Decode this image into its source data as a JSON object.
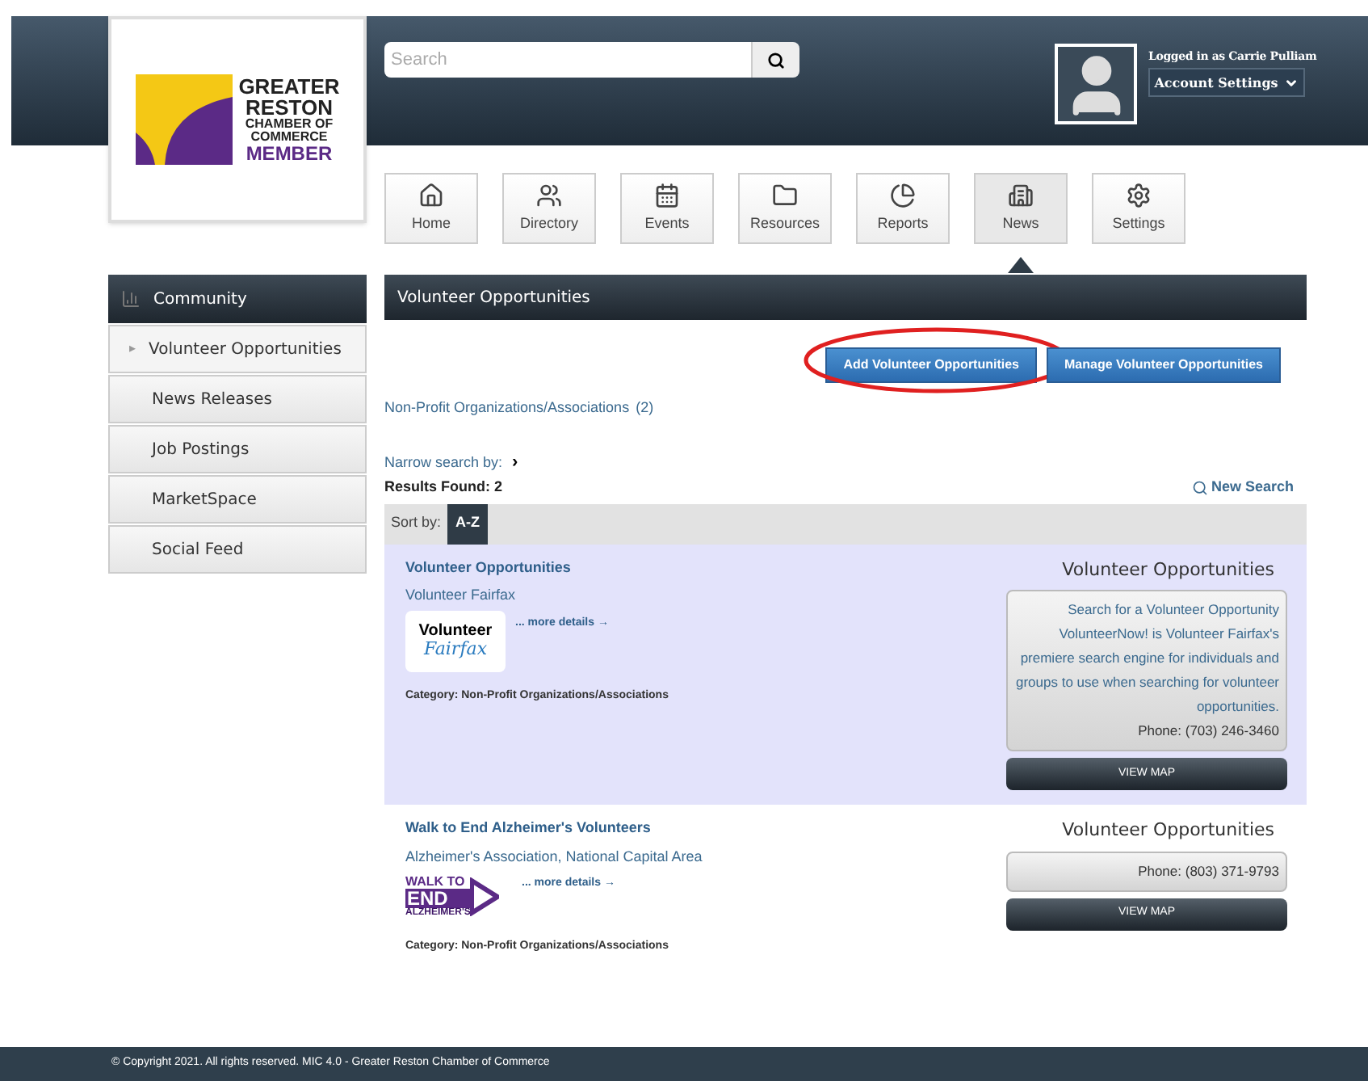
{
  "logo": {
    "lines": [
      "GREATER",
      "RESTON",
      "CHAMBER OF",
      "COMMERCE",
      "MEMBER"
    ]
  },
  "search": {
    "placeholder": "Search"
  },
  "user": {
    "status": "Logged in as Carrie Pulliam",
    "menu": "Account Settings"
  },
  "nav": [
    {
      "label": "Home",
      "selected": false
    },
    {
      "label": "Directory",
      "selected": false
    },
    {
      "label": "Events",
      "selected": false
    },
    {
      "label": "Resources",
      "selected": false
    },
    {
      "label": "Reports",
      "selected": false
    },
    {
      "label": "News",
      "selected": true
    },
    {
      "label": "Settings",
      "selected": false
    }
  ],
  "sidebar": {
    "title": "Community",
    "selected_marker": "▸",
    "items": [
      {
        "label": "Volunteer Opportunities",
        "selected": true
      },
      {
        "label": "News Releases",
        "selected": false
      },
      {
        "label": "Job Postings",
        "selected": false
      },
      {
        "label": "MarketSpace",
        "selected": false
      },
      {
        "label": "Social Feed",
        "selected": false
      }
    ]
  },
  "page_title": "Volunteer Opportunities",
  "actions": [
    {
      "label": "Add Volunteer Opportunities",
      "circled": true
    },
    {
      "label": "Manage Volunteer Opportunities",
      "circled": false
    }
  ],
  "category_link": {
    "label": "Non-Profit Organizations/Associations",
    "count": "(2)"
  },
  "narrow_search": "Narrow search by:",
  "narrow_arrow": "›",
  "results_found": "Results Found: 2",
  "new_search": "New Search",
  "sort": {
    "label": "Sort by:",
    "option": "A-Z"
  },
  "results": [
    {
      "title": "Volunteer Opportunities",
      "org": "Volunteer Fairfax",
      "logo": {
        "kind": "fairfax",
        "lines": [
          "Volunteer",
          "Fairfax"
        ]
      },
      "more": "... more details →",
      "category": "Category: Non-Profit Organizations/Associations",
      "highlighted": true,
      "side_title": "Volunteer Opportunities",
      "description": "Search for a Volunteer Opportunity VolunteerNow! is Volunteer Fairfax's premiere search engine for individuals and groups to use when searching for volunteer opportunities.",
      "phone": "Phone: (703) 246-3460",
      "map": "VIEW MAP"
    },
    {
      "title": "Walk to End Alzheimer's Volunteers",
      "org": "Alzheimer's Association, National Capital Area",
      "logo": {
        "kind": "walk",
        "lines": [
          "WALK TO",
          "END",
          "ALZHEIMER'S"
        ]
      },
      "more": "... more details →",
      "category": "Category: Non-Profit Organizations/Associations",
      "highlighted": false,
      "side_title": "Volunteer Opportunities",
      "phone": "Phone: (803) 371-9793",
      "map": "VIEW MAP"
    }
  ],
  "footer": "© Copyright 2021. All rights reserved. MIC 4.0 - Greater Reston Chamber of Commerce"
}
